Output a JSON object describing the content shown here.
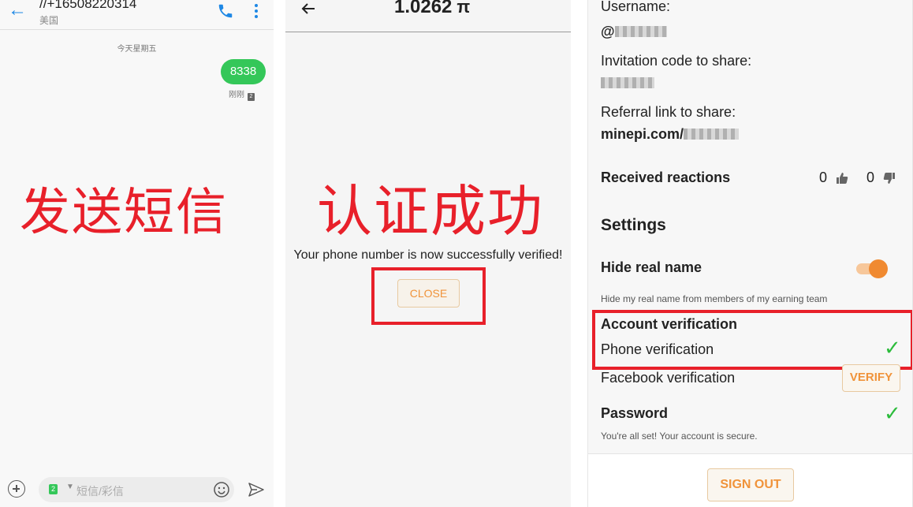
{
  "sms": {
    "number": "//+16508220314",
    "country": "美国",
    "date_separator": "今天星期五",
    "message": "8338",
    "message_time": "刚刚",
    "sim_badge": "2",
    "overlay_text": "发送短信",
    "input_placeholder": "短信/彩信",
    "sim_label": "2"
  },
  "verify": {
    "balance": "1.0262",
    "pi_symbol": "π",
    "overlay_text": "认证成功",
    "success_message": "Your phone number is now successfully verified!",
    "close_label": "CLOSE"
  },
  "profile": {
    "username_label": "Username:",
    "username_value": "@",
    "invitation_label": "Invitation code to share:",
    "referral_label": "Referral link to share:",
    "referral_value": "minepi.com/",
    "reactions_label": "Received reactions",
    "thumbs_up_count": "0",
    "thumbs_down_count": "0",
    "settings_heading": "Settings",
    "hide_name_label": "Hide real name",
    "hide_name_toggle": "on",
    "hide_name_desc": "Hide my real name from members of my earning team",
    "account_verification_label": "Account verification",
    "phone_verification_label": "Phone verification",
    "facebook_verification_label": "Facebook verification",
    "verify_button": "VERIFY",
    "password_label": "Password",
    "password_desc": "You're all set! Your account is secure.",
    "sign_out_label": "SIGN OUT",
    "check_mark": "✓"
  },
  "colors": {
    "accent_orange": "#f0933a",
    "success_green": "#2cbc3c",
    "annotation_red": "#e8202a",
    "sms_bubble_green": "#34c759",
    "link_blue": "#1e88e5"
  }
}
